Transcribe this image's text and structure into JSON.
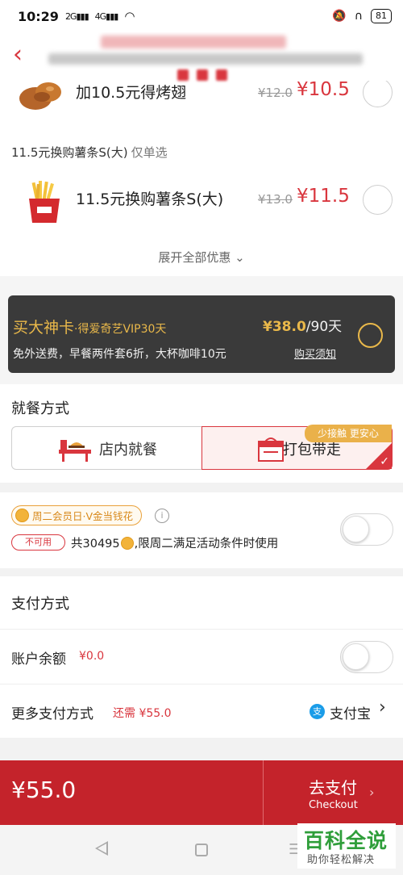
{
  "status_bar": {
    "time": "10:29",
    "signal_1": "2G",
    "signal_2": "4G",
    "battery": "81"
  },
  "offers": {
    "wings": {
      "name": "加10.5元得烤翅",
      "old_price": "¥12.0",
      "price": "¥10.5",
      "icon": "roast-wings-image"
    },
    "fries_group_title": "11.5元换购薯条S(大)",
    "fries_group_sub": "仅单选",
    "fries": {
      "name": "11.5元换购薯条S(大)",
      "old_price": "¥13.0",
      "price": "¥11.5",
      "icon": "fries-image"
    },
    "expand_label": "展开全部优惠"
  },
  "vip": {
    "title": "买大神卡",
    "title_sub": "·得爱奇艺VIP30天",
    "desc": "免外送费，早餐两件套6折，大杯咖啡10元",
    "price": "¥38.0",
    "per": "/90天",
    "link": "购买须知"
  },
  "dining": {
    "title": "就餐方式",
    "dine_in": "店内就餐",
    "takeaway": "打包带走",
    "tag": "少接触 更安心"
  },
  "member": {
    "badge": "周二会员日·V金当钱花",
    "unavailable": "不可用",
    "desc_prefix": "共30495",
    "desc_suffix": ",限周二满足活动条件时使用"
  },
  "payment": {
    "title": "支付方式",
    "balance_label": "账户余额",
    "balance_amount": "¥0.0",
    "more_label": "更多支付方式",
    "more_need": "还需 ¥55.0",
    "alipay_icon": "支",
    "alipay_label": "支付宝"
  },
  "footer": {
    "total": "¥55.0",
    "pay_cn": "去支付",
    "pay_en": "Checkout"
  },
  "watermark": {
    "title": "百科全说",
    "sub": "助你轻松解决"
  },
  "colors": {
    "brand_red": "#d9363e",
    "footer_red": "#c4232b",
    "gold": "#e9b84a",
    "vip_bg": "#3a3a3a"
  }
}
